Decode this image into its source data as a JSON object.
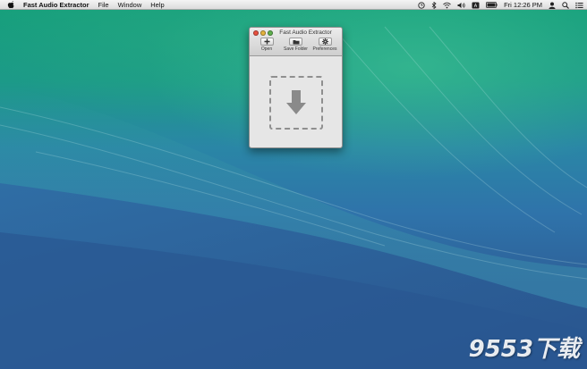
{
  "menubar": {
    "app_name": "Fast Audio Extractor",
    "menus": [
      "File",
      "Window",
      "Help"
    ],
    "clock": "Fri 12:26 PM",
    "status_icons": [
      "time-machine-icon",
      "bluetooth-icon",
      "wifi-icon",
      "volume-icon",
      "input-menu-icon",
      "battery-icon",
      "user-icon",
      "search-icon",
      "notification-center-icon"
    ]
  },
  "window": {
    "title": "Fast Audio Extractor",
    "toolbar": {
      "open_label": "Open",
      "save_folder_label": "Save Folder",
      "preferences_label": "Preferences"
    },
    "drop_zone_icon": "download-arrow-icon"
  },
  "watermark": {
    "text": "9553下载"
  },
  "colors": {
    "wallpaper_top": "#16a07a",
    "wallpaper_bottom": "#284f86",
    "window_bg": "#e6e6e6",
    "close": "#e8503f",
    "minimize": "#e3b23c",
    "zoom": "#5fb04d"
  }
}
